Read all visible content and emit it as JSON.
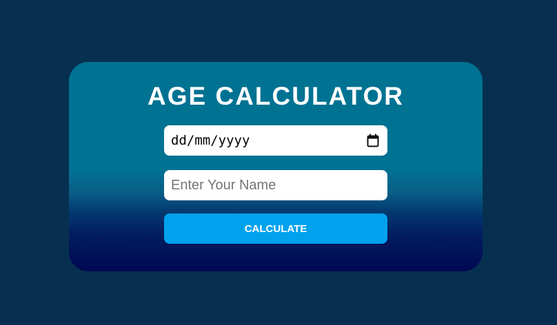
{
  "card": {
    "title": "AGE CALCULATOR"
  },
  "form": {
    "date_placeholder": "dd/mm/yyyy",
    "date_icon": "calendar-icon",
    "name_placeholder": "Enter Your Name",
    "name_value": "",
    "button_label": "CALCULATE"
  },
  "colors": {
    "page_background": "#073050",
    "card_top": "#007292",
    "card_bottom": "#000853",
    "button": "#00a2ed"
  }
}
